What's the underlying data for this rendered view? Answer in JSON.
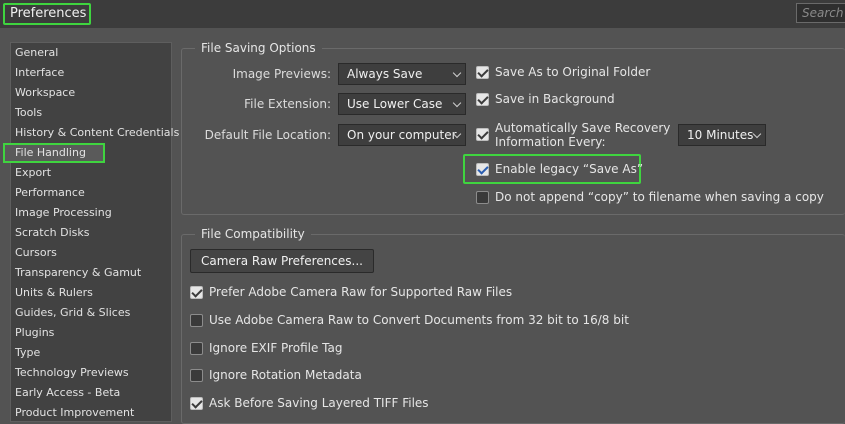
{
  "window": {
    "title": "Preferences",
    "search_placeholder": "Search"
  },
  "sidebar": {
    "items": [
      "General",
      "Interface",
      "Workspace",
      "Tools",
      "History & Content Credentials",
      "File Handling",
      "Export",
      "Performance",
      "Image Processing",
      "Scratch Disks",
      "Cursors",
      "Transparency & Gamut",
      "Units & Rulers",
      "Guides, Grid & Slices",
      "Plugins",
      "Type",
      "Technology Previews",
      "Early Access - Beta",
      "Product Improvement"
    ],
    "active": "File Handling"
  },
  "file_saving": {
    "title": "File Saving Options",
    "image_previews": {
      "label": "Image Previews:",
      "value": "Always Save"
    },
    "file_extension": {
      "label": "File Extension:",
      "value": "Use Lower Case"
    },
    "default_location": {
      "label": "Default File Location:",
      "value": "On your computer"
    },
    "save_as_original": {
      "label": "Save As to Original Folder",
      "checked": true
    },
    "save_background": {
      "label": "Save in Background",
      "checked": true
    },
    "auto_recovery": {
      "label_line1": "Automatically Save Recovery",
      "label_line2": "Information Every:",
      "checked": true,
      "interval": "10 Minutes"
    },
    "legacy_save_as": {
      "label": "Enable legacy “Save As”",
      "checked": true
    },
    "no_copy_suffix": {
      "label": "Do not append “copy” to filename when saving a copy",
      "checked": false
    }
  },
  "file_compat": {
    "title": "File Compatibility",
    "camera_raw_button": "Camera Raw Preferences...",
    "options": [
      {
        "label": "Prefer Adobe Camera Raw for Supported Raw Files",
        "checked": true
      },
      {
        "label": "Use Adobe Camera Raw to Convert Documents from 32 bit to 16/8 bit",
        "checked": false
      },
      {
        "label": "Ignore EXIF Profile Tag",
        "checked": false
      },
      {
        "label": "Ignore Rotation Metadata",
        "checked": false
      },
      {
        "label": "Ask Before Saving Layered TIFF Files",
        "checked": true
      }
    ]
  },
  "colors": {
    "background": "#535353",
    "highlight": "#3fd43f",
    "panel": "#424242"
  }
}
